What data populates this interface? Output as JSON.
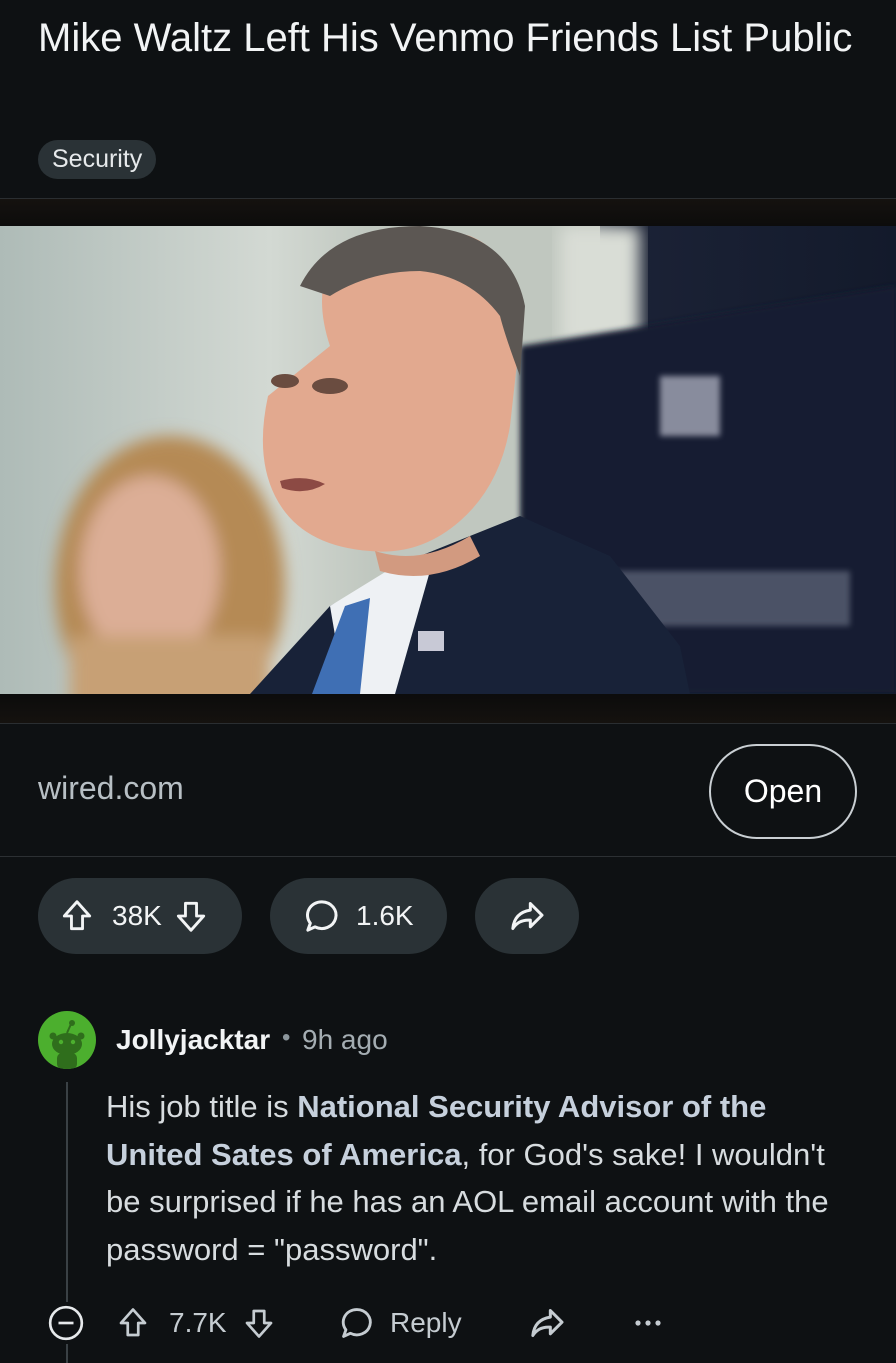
{
  "post": {
    "title": "Mike Waltz Left His Venmo Friends List Public",
    "flair": "Security",
    "link_domain": "wired.com",
    "open_label": "Open",
    "upvotes": "38K",
    "comments": "1.6K"
  },
  "comment": {
    "username": "Jollyjacktar",
    "separator": "•",
    "time_ago": "9h ago",
    "body_part1": "His job title is ",
    "body_bold": "National Security Advisor of the United Sates of America",
    "body_part2": ", for God's sake! I wouldn't be surprised if he has an AOL email account with the password = \"password\".",
    "votes": "7.7K",
    "reply_label": "Reply"
  },
  "icons": {
    "upvote": "arrow-up-icon",
    "downvote": "arrow-down-icon",
    "comment": "speech-bubble-icon",
    "share": "share-arrow-icon",
    "collapse": "minus-circle-icon",
    "more": "ellipsis-icon"
  },
  "colors": {
    "background": "#0e1113",
    "pill": "#2a3236",
    "avatar": "#4caf2e"
  }
}
